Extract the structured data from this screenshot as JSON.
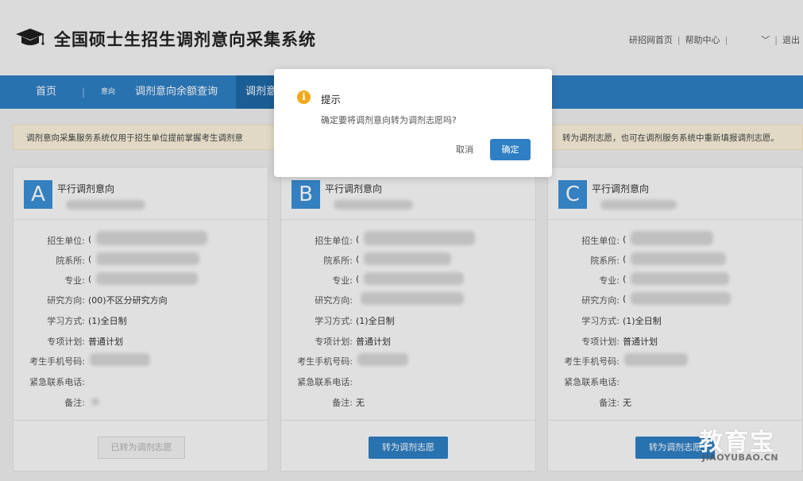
{
  "header": {
    "site_title": "全国硕士生招生调剂意向采集系统",
    "links": [
      "研招网首页",
      "帮助中心"
    ],
    "user_dropdown": "﹀",
    "logout": "退出"
  },
  "nav": {
    "home": "首页",
    "intent": "意向",
    "quota_query": "调剂意向余额查询",
    "active_tab": "调剂意"
  },
  "notice": {
    "left_text": "调剂意向采集服务系统仅用于招生单位提前掌握考生调剂意",
    "right_text": "转为调剂志愿，也可在调剂服务系统中重新填报调剂志愿。"
  },
  "labels": {
    "unit": "招生单位:",
    "dept": "院系所:",
    "major": "专业:",
    "direction": "研究方向:",
    "study_mode": "学习方式:",
    "program": "专项计划:",
    "phone": "考生手机号码:",
    "emergency": "紧急联系电话:",
    "remark": "备注:"
  },
  "cards": [
    {
      "letter": "A",
      "title": "平行调剂意向",
      "unit_prefix": "(",
      "dept_prefix": "(",
      "major_prefix": "(",
      "direction": "(00)不区分研究方向",
      "study_mode": "(1)全日制",
      "program": "普通计划",
      "remark": "",
      "button": "已转为调剂志愿",
      "button_disabled": true
    },
    {
      "letter": "B",
      "title": "平行调剂意向",
      "unit_prefix": "(",
      "dept_prefix": "(",
      "major_prefix": "(",
      "direction": "",
      "study_mode": "(1)全日制",
      "program": "普通计划",
      "remark": "无",
      "button": "转为调剂志愿",
      "button_disabled": false
    },
    {
      "letter": "C",
      "title": "平行调剂意向",
      "unit_prefix": "(",
      "dept_prefix": "(",
      "major_prefix": "(",
      "direction": "(",
      "study_mode": "(1)全日制",
      "program": "普通计划",
      "remark": "无",
      "button": "转为调剂志愿",
      "button_disabled": false
    }
  ],
  "dialog": {
    "icon": "i",
    "title": "提示",
    "message": "确定要将调剂意向转为调剂志愿吗?",
    "cancel": "取消",
    "confirm": "确定"
  },
  "watermark": {
    "main": "教育宝",
    "sub": "JIAOYUBAO.CN"
  },
  "colors": {
    "primary": "#2e7fc4",
    "warning": "#f0a81a",
    "notice_bg": "#fbf2dc"
  }
}
